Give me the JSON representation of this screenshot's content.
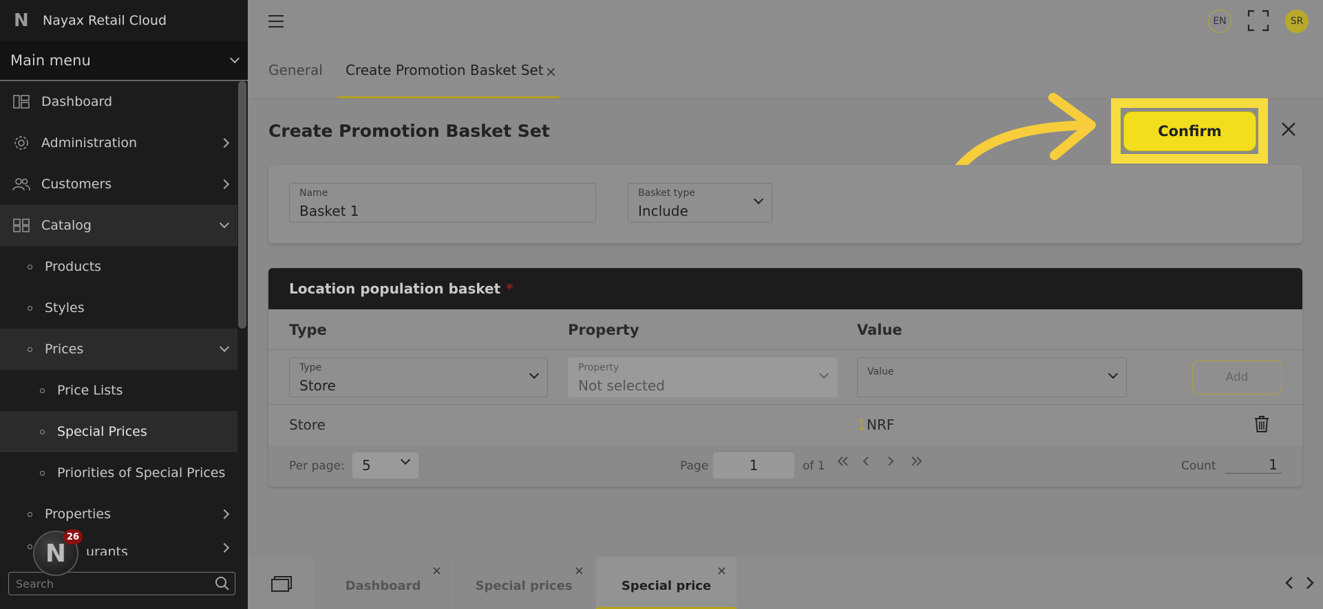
{
  "app": {
    "logo": "N",
    "name": "Nayax Retail Cloud"
  },
  "sidebar": {
    "main_menu": "Main menu",
    "items": [
      {
        "label": "Dashboard"
      },
      {
        "label": "Administration"
      },
      {
        "label": "Customers"
      },
      {
        "label": "Catalog"
      },
      {
        "label": "Products"
      },
      {
        "label": "Styles"
      },
      {
        "label": "Prices"
      },
      {
        "label": "Price Lists"
      },
      {
        "label": "Special Prices"
      },
      {
        "label": "Priorities of Special Prices"
      },
      {
        "label": "Properties"
      },
      {
        "label": "urants"
      }
    ],
    "search_placeholder": "Search",
    "notification_count": "26"
  },
  "topbar": {
    "language": "EN",
    "user_initials": "SR"
  },
  "tabs": [
    {
      "label": "General"
    },
    {
      "label": "Create Promotion Basket Set"
    }
  ],
  "page": {
    "title": "Create Promotion Basket Set",
    "confirm_label": "Confirm"
  },
  "form": {
    "name_label": "Name",
    "name_value": "Basket 1",
    "basket_type_label": "Basket type",
    "basket_type_value": "Include"
  },
  "basket": {
    "header": "Location population basket",
    "required_mark": "*",
    "columns": [
      "Type",
      "Property",
      "Value"
    ],
    "type_label": "Type",
    "type_value": "Store",
    "property_label": "Property",
    "property_value": "Not selected",
    "value_label": "Value",
    "add_label": "Add",
    "rows": [
      {
        "type": "Store",
        "value_prefix": "1",
        "value": "NRF"
      }
    ],
    "pager": {
      "per_page_label": "Per page:",
      "per_page_value": "5",
      "page_label": "Page",
      "page_value": "1",
      "of_label": "of 1",
      "count_label": "Count",
      "count_value": "1"
    }
  },
  "bottom_tabs": [
    {
      "label": "Dashboard"
    },
    {
      "label": "Special prices"
    },
    {
      "label": "Special price"
    }
  ],
  "colors": {
    "accent": "#f2de1c",
    "highlight": "#f6dc3e",
    "sidebar": "#1c1c1c"
  }
}
